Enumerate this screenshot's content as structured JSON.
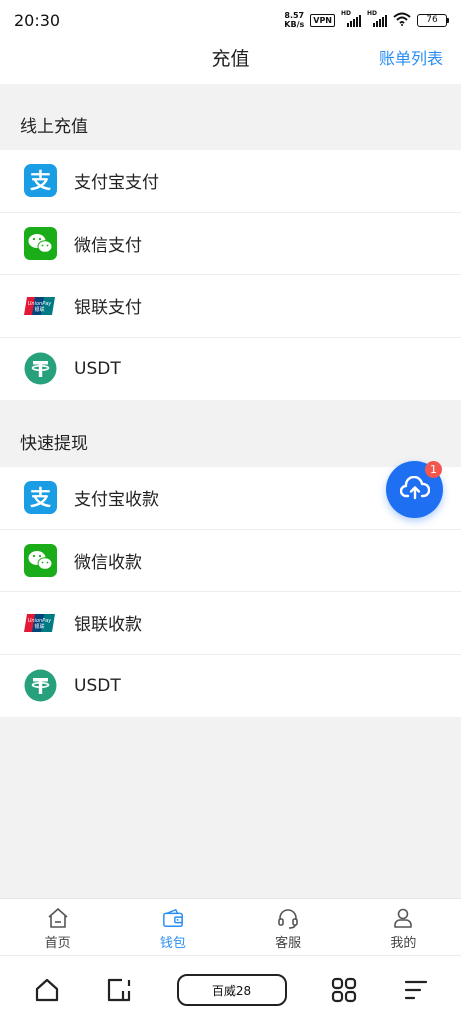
{
  "status_bar": {
    "time": "20:30",
    "net_speed_value": "8.57",
    "net_speed_unit": "KB/s",
    "vpn": "VPN",
    "signal_label": "HD",
    "battery": "76"
  },
  "header": {
    "title": "充值",
    "right_link": "账单列表"
  },
  "sections": [
    {
      "title": "线上充值",
      "items": [
        {
          "label": "支付宝支付",
          "icon": "alipay-icon"
        },
        {
          "label": "微信支付",
          "icon": "wechat-icon"
        },
        {
          "label": "银联支付",
          "icon": "unionpay-icon"
        },
        {
          "label": "USDT",
          "icon": "tether-icon"
        }
      ]
    },
    {
      "title": "快速提现",
      "items": [
        {
          "label": "支付宝收款",
          "icon": "alipay-icon"
        },
        {
          "label": "微信收款",
          "icon": "wechat-icon"
        },
        {
          "label": "银联收款",
          "icon": "unionpay-icon"
        },
        {
          "label": "USDT",
          "icon": "tether-icon"
        }
      ]
    }
  ],
  "fab": {
    "icon": "cloud-upload-icon",
    "badge": "1"
  },
  "tab_bar": {
    "tabs": [
      {
        "label": "首页",
        "icon": "home-icon"
      },
      {
        "label": "钱包",
        "icon": "wallet-icon",
        "active": true
      },
      {
        "label": "客服",
        "icon": "headset-icon"
      },
      {
        "label": "我的",
        "icon": "profile-icon"
      }
    ]
  },
  "system_nav": {
    "center_label": "百威28"
  },
  "colors": {
    "accent": "#2a8ef5",
    "fab": "#1e6ff2",
    "badge": "#f4574d",
    "alipay": "#1a9de5",
    "wechat": "#1aad19",
    "tether": "#26a17b"
  }
}
